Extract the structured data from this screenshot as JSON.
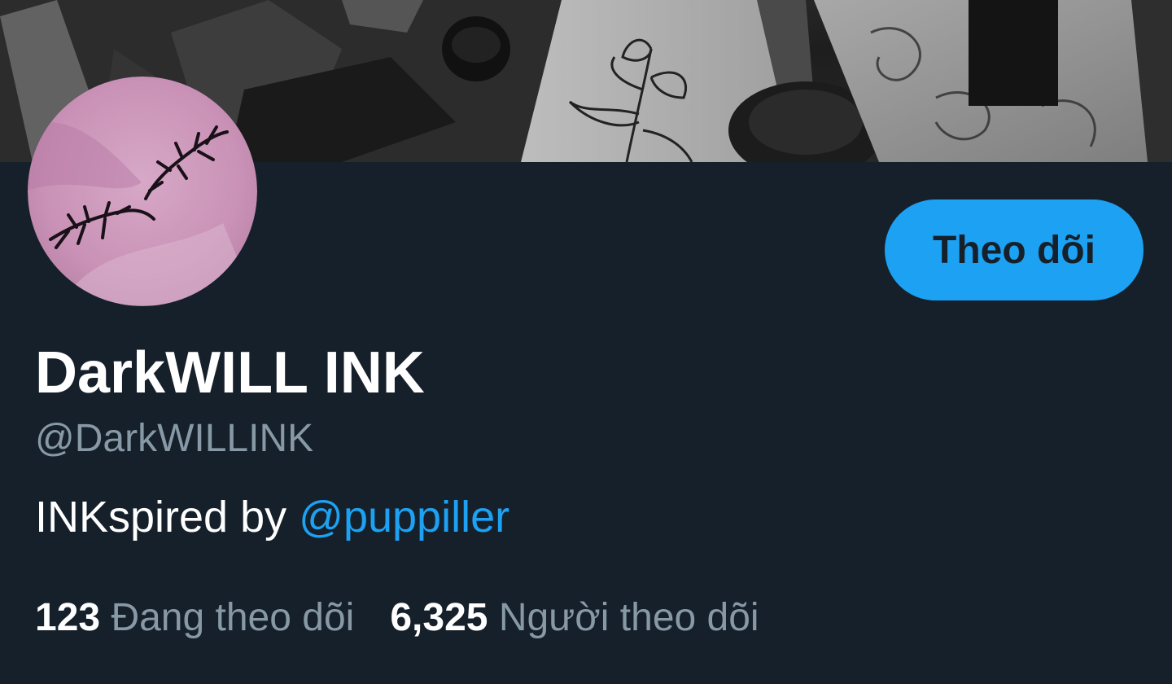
{
  "banner": {
    "icon": "tattoo-banner-image"
  },
  "avatar": {
    "icon": "tattoo-avatar-image"
  },
  "follow_button": {
    "label": "Theo dõi",
    "color": "#1da1f2"
  },
  "profile": {
    "display_name": "DarkWILL INK",
    "handle": "@DarkWILLINK",
    "bio_text": "INKspired by ",
    "bio_mention": "@puppiller"
  },
  "stats": {
    "following_count": "123",
    "following_label": "Đang theo dõi",
    "followers_count": "6,325",
    "followers_label": "Người theo dõi"
  },
  "colors": {
    "background": "#15202b",
    "accent": "#1da1f2",
    "secondary_text": "#8899a6"
  }
}
